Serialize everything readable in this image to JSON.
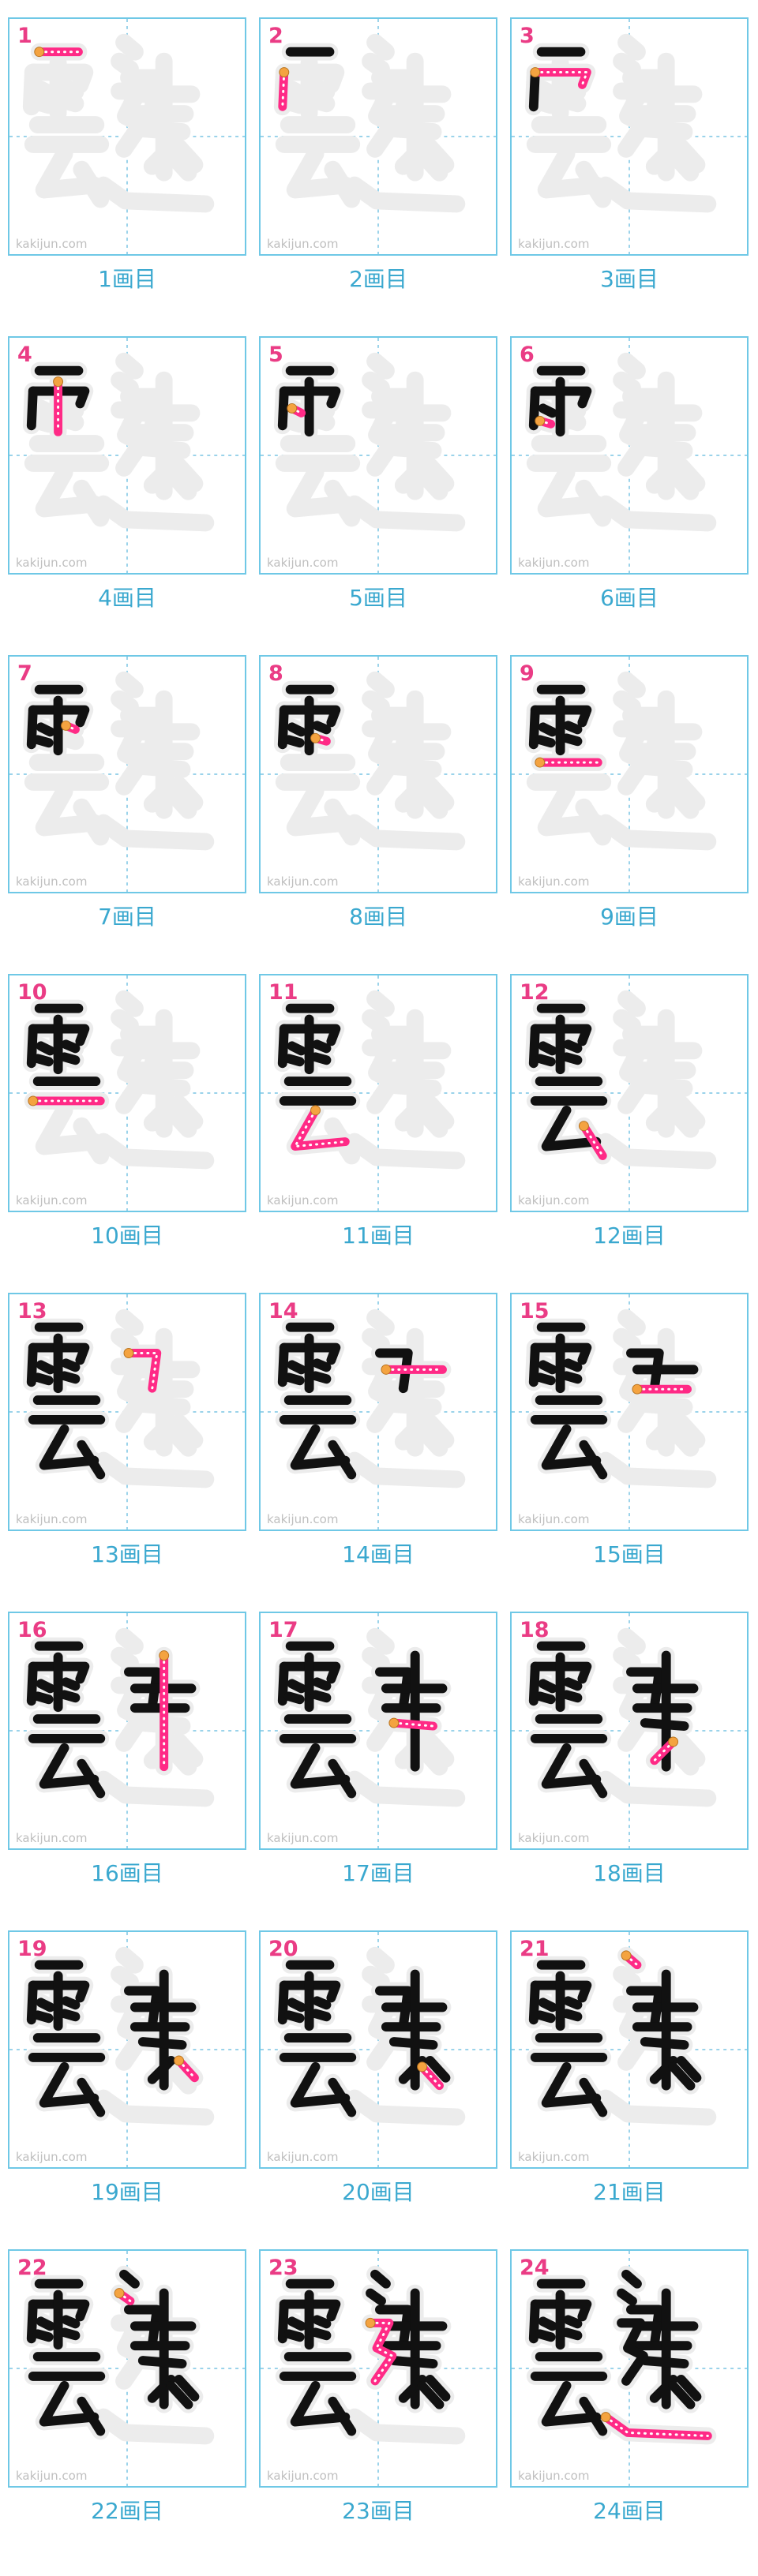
{
  "watermark": "kakijun.com",
  "label_suffix": "画目",
  "frames": [
    {
      "number": "1",
      "label": "1画目"
    },
    {
      "number": "2",
      "label": "2画目"
    },
    {
      "number": "3",
      "label": "3画目"
    },
    {
      "number": "4",
      "label": "4画目"
    },
    {
      "number": "5",
      "label": "5画目"
    },
    {
      "number": "6",
      "label": "6画目"
    },
    {
      "number": "7",
      "label": "7画目"
    },
    {
      "number": "8",
      "label": "8画目"
    },
    {
      "number": "9",
      "label": "9画目"
    },
    {
      "number": "10",
      "label": "10画目"
    },
    {
      "number": "11",
      "label": "11画目"
    },
    {
      "number": "12",
      "label": "12画目"
    },
    {
      "number": "13",
      "label": "13画目"
    },
    {
      "number": "14",
      "label": "14画目"
    },
    {
      "number": "15",
      "label": "15画目"
    },
    {
      "number": "16",
      "label": "16画目"
    },
    {
      "number": "17",
      "label": "17画目"
    },
    {
      "number": "18",
      "label": "18画目"
    },
    {
      "number": "19",
      "label": "19画目"
    },
    {
      "number": "20",
      "label": "20画目"
    },
    {
      "number": "21",
      "label": "21画目"
    },
    {
      "number": "22",
      "label": "22画目"
    },
    {
      "number": "23",
      "label": "23画目"
    },
    {
      "number": "24",
      "label": "24画目"
    }
  ],
  "colors": {
    "frame_border": "#6fc8e6",
    "guide_line": "#9bd3ea",
    "number": "#ea3c85",
    "label": "#3aa8cf",
    "ghost": "#ececec",
    "ink": "#111111",
    "current_stroke": "#ff2a86",
    "stroke_start_dot": "#f4a340",
    "watermark": "#bfbfbf"
  }
}
